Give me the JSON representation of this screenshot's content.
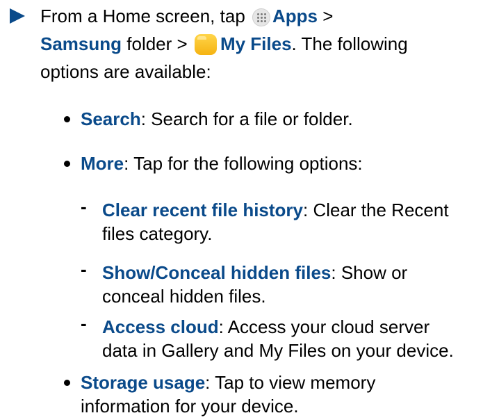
{
  "step": {
    "line1": {
      "prefix": "From a Home screen, tap ",
      "apps_icon": "apps-grid-icon",
      "apps_label": "Apps",
      "separator": " >"
    },
    "line2": {
      "samsung_label": "Samsung",
      "folder_text": " folder > ",
      "folder_icon": "my-files-folder-icon",
      "my_files_label": "My Files",
      "suffix": ". The following"
    },
    "line3": "options are available:"
  },
  "options": [
    {
      "name": "Search",
      "desc": ": Search for a file or folder."
    },
    {
      "name": "More",
      "desc": ": Tap for the following options:",
      "sub_options": [
        {
          "name": "Clear recent file history",
          "desc_line1": ": Clear the Recent",
          "desc_line2": "files category."
        },
        {
          "name": "Show/Conceal hidden files",
          "desc_line1": ": Show or",
          "desc_line2": "conceal hidden files."
        },
        {
          "name": "Access cloud",
          "desc_line1": ": Access your cloud server",
          "desc_line2": "data in Gallery and My Files on your device."
        }
      ]
    },
    {
      "name": "Storage usage",
      "desc_line1": ": Tap to view memory",
      "desc_line2": "information for your device."
    }
  ],
  "colors": {
    "heading_blue": "#0a4a8a",
    "folder_yellow": "#f5b312",
    "text": "#000000"
  }
}
